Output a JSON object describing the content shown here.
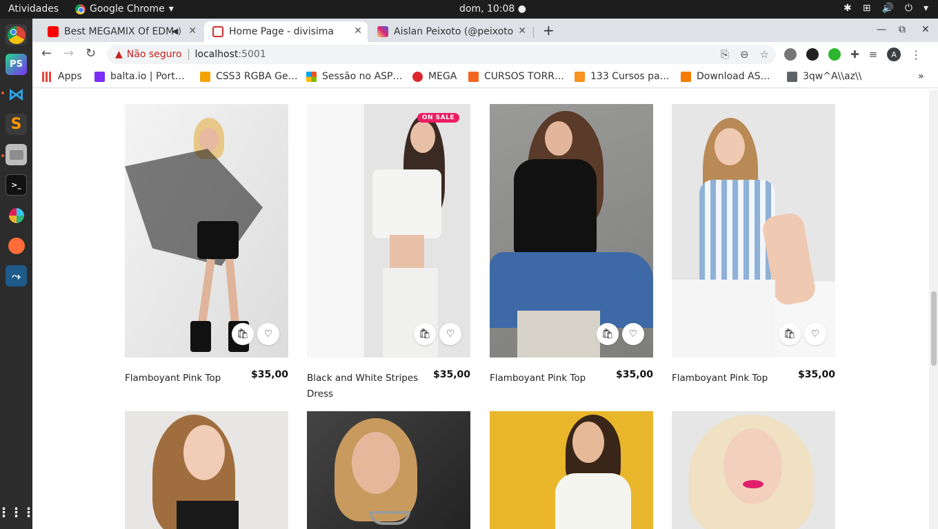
{
  "topbar": {
    "activities": "Atividades",
    "app_name": "Google Chrome",
    "clock": "dom, 10:08 ●"
  },
  "tabs": [
    {
      "title": "Best MEGAMIX Of EDM",
      "favicon_color": "#ff0000"
    },
    {
      "title": "Home Page - divisima",
      "favicon_color": "#d32f2f"
    },
    {
      "title": "Aislan Peixoto (@peixoto",
      "favicon_color": "#c13584"
    }
  ],
  "omnibox": {
    "warning": "Não seguro",
    "host": "localhost",
    "port": ":5001"
  },
  "bookmarks": [
    {
      "label": "Apps",
      "color": "#ea4335"
    },
    {
      "label": "balta.io | Port…",
      "color": "#7b2ff7"
    },
    {
      "label": "CSS3 RGBA Ge…",
      "color": "#f4a300"
    },
    {
      "label": "Sessão no ASP…",
      "color": "#00a4ef"
    },
    {
      "label": "MEGA",
      "color": "#d9272e"
    },
    {
      "label": "CURSOS TORR…",
      "color": "#f26522"
    },
    {
      "label": "133 Cursos pa…",
      "color": "#f7931e"
    },
    {
      "label": "Download AS…",
      "color": "#f57c00"
    },
    {
      "label": "3qw^A\\\\az\\\\",
      "color": "#5f6368"
    }
  ],
  "products": [
    {
      "name": "Flamboyant Pink Top",
      "price": "$35,00",
      "sale": false
    },
    {
      "name": "Black and White Stripes Dress",
      "price": "$35,00",
      "sale": true,
      "badge": "ON SALE"
    },
    {
      "name": "Flamboyant Pink Top",
      "price": "$35,00",
      "sale": false
    },
    {
      "name": "Flamboyant Pink Top",
      "price": "$35,00",
      "sale": false
    }
  ],
  "buttons": {
    "bag_icon": "🛍",
    "heart_icon": "♡"
  },
  "avatar_letter": "A"
}
